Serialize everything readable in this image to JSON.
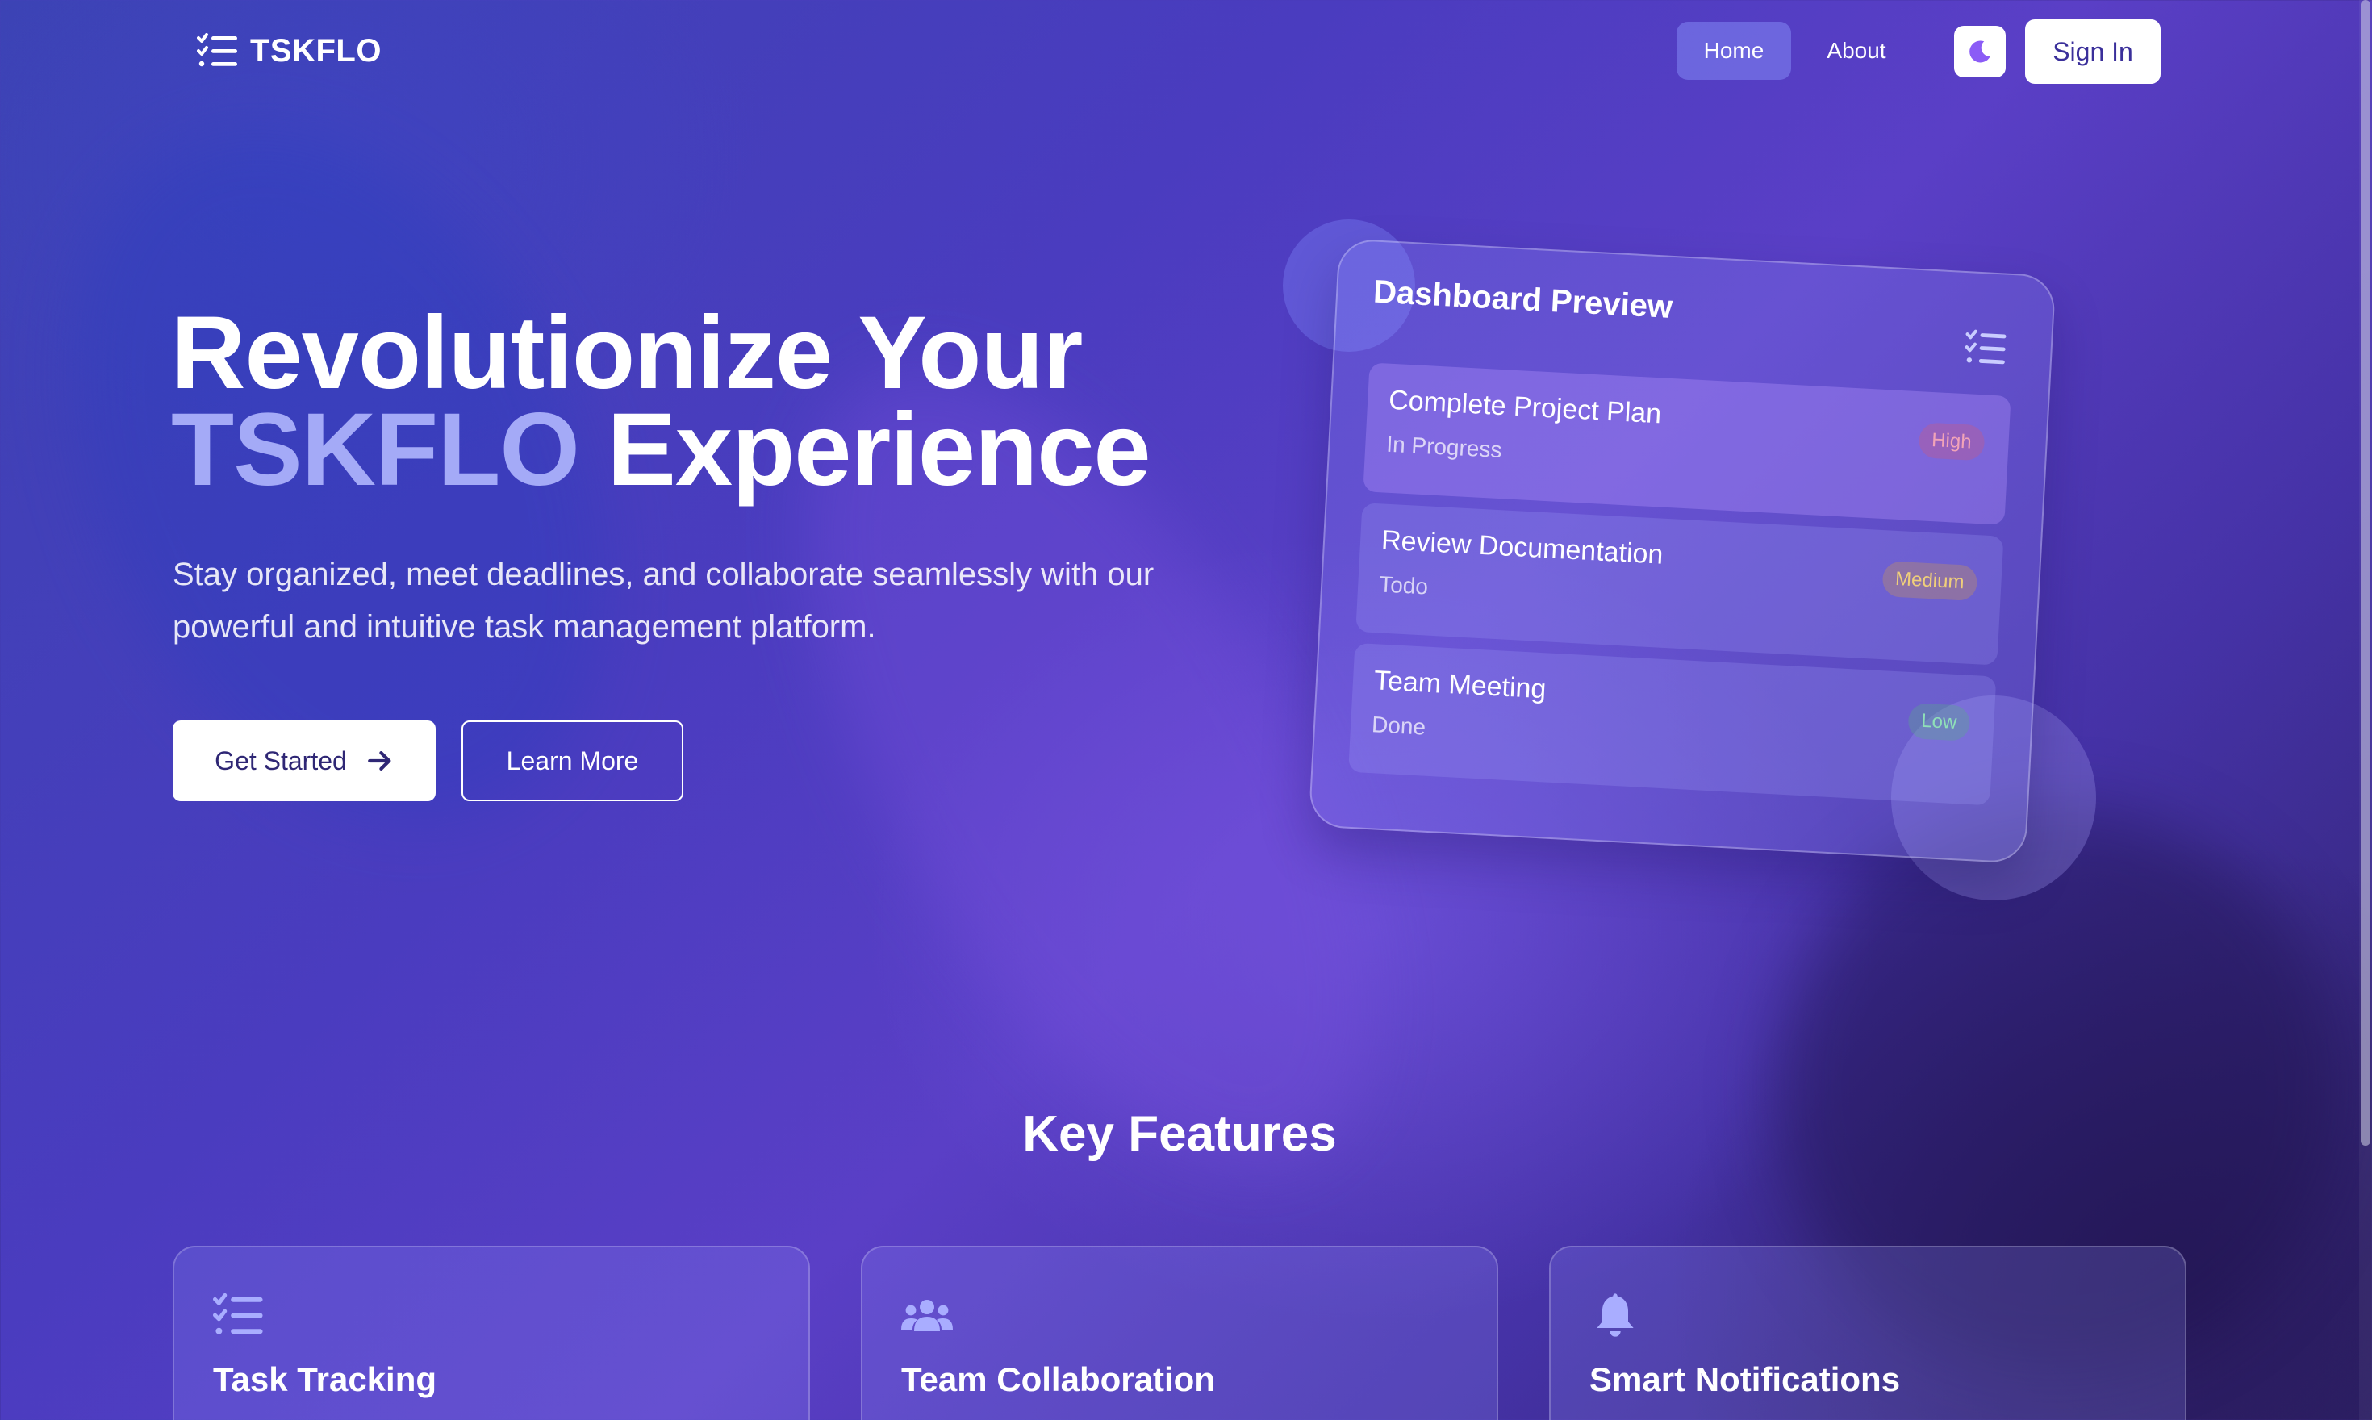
{
  "colors": {
    "accent": "#a4aaf7",
    "button_text": "#2f2775",
    "badge_high": "#e58aa5",
    "badge_medium": "#e9c46a",
    "badge_low": "#6fd3a3"
  },
  "nav": {
    "brand": "TSKFLO",
    "brand_icon": "list-check-icon",
    "links": [
      {
        "label": "Home",
        "active": true
      },
      {
        "label": "About",
        "active": false
      }
    ],
    "theme_icon": "moon-icon",
    "sign_in": "Sign In"
  },
  "hero": {
    "title_line1": "Revolutionize Your",
    "title_brand": "TSKFLO",
    "title_rest": " Experience",
    "subtitle": "Stay organized, meet deadlines, and collaborate seamlessly with our powerful and intuitive task management platform.",
    "primary_button": "Get Started",
    "primary_button_icon": "arrow-right-icon",
    "secondary_button": "Learn More"
  },
  "dashboard": {
    "title": "Dashboard Preview",
    "icon": "list-check-icon",
    "tasks": [
      {
        "name": "Complete Project Plan",
        "status": "In Progress",
        "priority": "High"
      },
      {
        "name": "Review Documentation",
        "status": "Todo",
        "priority": "Medium"
      },
      {
        "name": "Team Meeting",
        "status": "Done",
        "priority": "Low"
      }
    ]
  },
  "features": {
    "title": "Key Features",
    "items": [
      {
        "name": "Task Tracking",
        "icon": "list-check-icon"
      },
      {
        "name": "Team Collaboration",
        "icon": "users-icon"
      },
      {
        "name": "Smart Notifications",
        "icon": "bell-icon"
      }
    ]
  }
}
